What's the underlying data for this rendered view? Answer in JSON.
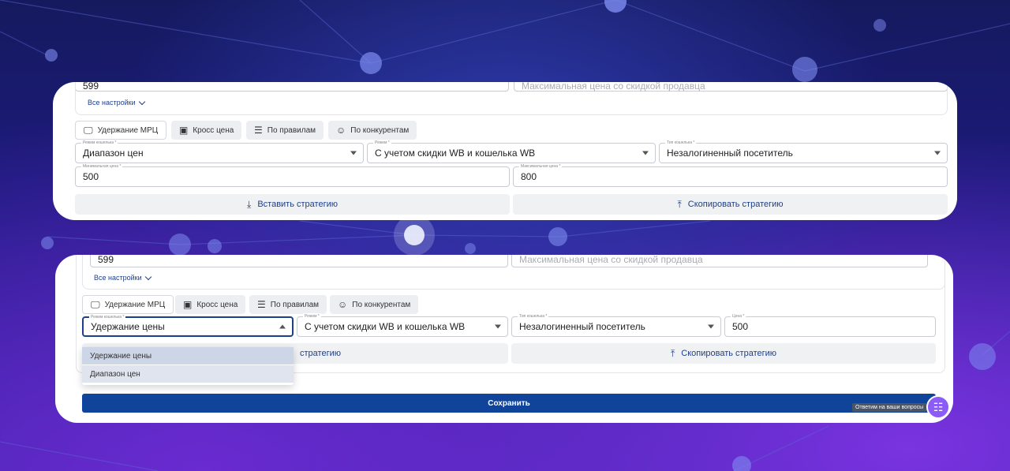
{
  "panel_top": {
    "prev_min_price": "599",
    "max_price_placeholder": "Максимальная цена со скидкой продавца",
    "all_settings": "Все настройки",
    "tabs": [
      {
        "label": "Удержание МРЦ",
        "icon": "monitor-icon"
      },
      {
        "label": "Кросс цена",
        "icon": "price-tag-icon"
      },
      {
        "label": "По правилам",
        "icon": "rules-icon"
      },
      {
        "label": "По конкурентам",
        "icon": "users-icon"
      }
    ],
    "wallet_mode": {
      "label": "Режим кошелька *",
      "value": "Диапазон цен"
    },
    "mode": {
      "label": "Режим *",
      "value": "С учетом скидки WB и кошелька WB"
    },
    "wallet_type": {
      "label": "Тип кошелька *",
      "value": "Незалогиненный посетитель"
    },
    "min_price": {
      "label": "Минимальная цена *",
      "value": "500"
    },
    "max_price": {
      "label": "Максимальная цена *",
      "value": "800"
    },
    "insert_strategy": "Вставить стратегию",
    "copy_strategy": "Скопировать стратегию"
  },
  "panel_bottom": {
    "prev_min_price": "599",
    "max_price_placeholder": "Максимальная цена со скидкой продавца",
    "all_settings": "Все настройки",
    "tabs": [
      {
        "label": "Удержание МРЦ",
        "icon": "monitor-icon"
      },
      {
        "label": "Кросс цена",
        "icon": "price-tag-icon"
      },
      {
        "label": "По правилам",
        "icon": "rules-icon"
      },
      {
        "label": "По конкурентам",
        "icon": "users-icon"
      }
    ],
    "wallet_mode": {
      "label": "Режим кошелька *",
      "value": "Удержание цены"
    },
    "mode": {
      "label": "Режим *",
      "value": "С учетом скидки WB и кошелька WB"
    },
    "wallet_type": {
      "label": "Тип кошелька *",
      "value": "Незалогиненный посетитель"
    },
    "price": {
      "label": "Цена *",
      "value": "500"
    },
    "dropdown_options": [
      "Удержание цены",
      "Диапазон цен"
    ],
    "insert_strategy_partial": "стратегию",
    "copy_strategy": "Скопировать стратегию",
    "save": "Сохранить",
    "chat_tooltip": "Ответим на ваши вопросы"
  }
}
